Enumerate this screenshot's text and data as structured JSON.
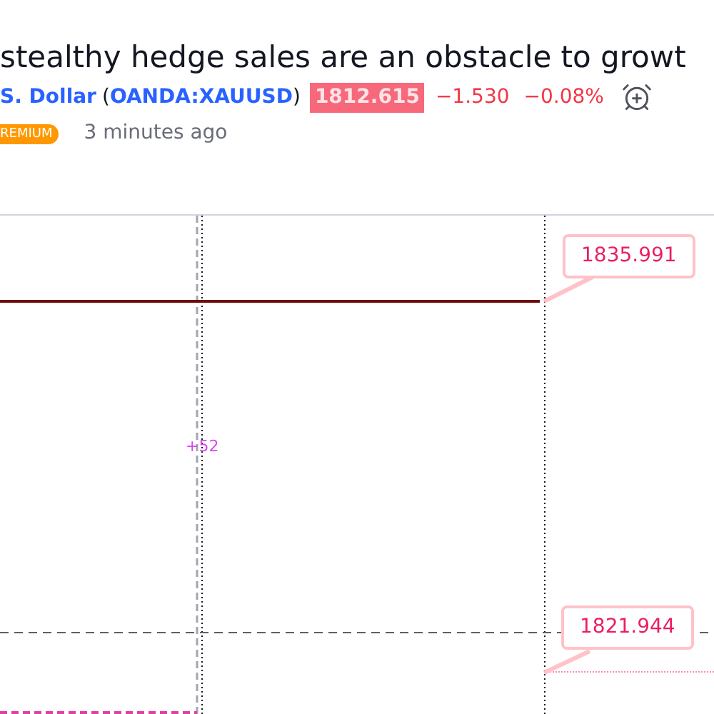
{
  "headline": "stealthy hedge sales are an obstacle to growt",
  "symbol": {
    "name": "S. Dollar",
    "open_bracket": "(",
    "ticker": "OANDA:XAUUSD",
    "close_bracket": ")"
  },
  "quote": {
    "price": "1812.615",
    "change": "−1.530",
    "change_percent": "−0.08%"
  },
  "badge": "REMIUM",
  "time": "3 minutes ago",
  "chart": {
    "bar_count": "+52",
    "labels": [
      {
        "text": "1835.991"
      },
      {
        "text": "1821.944"
      }
    ]
  }
}
